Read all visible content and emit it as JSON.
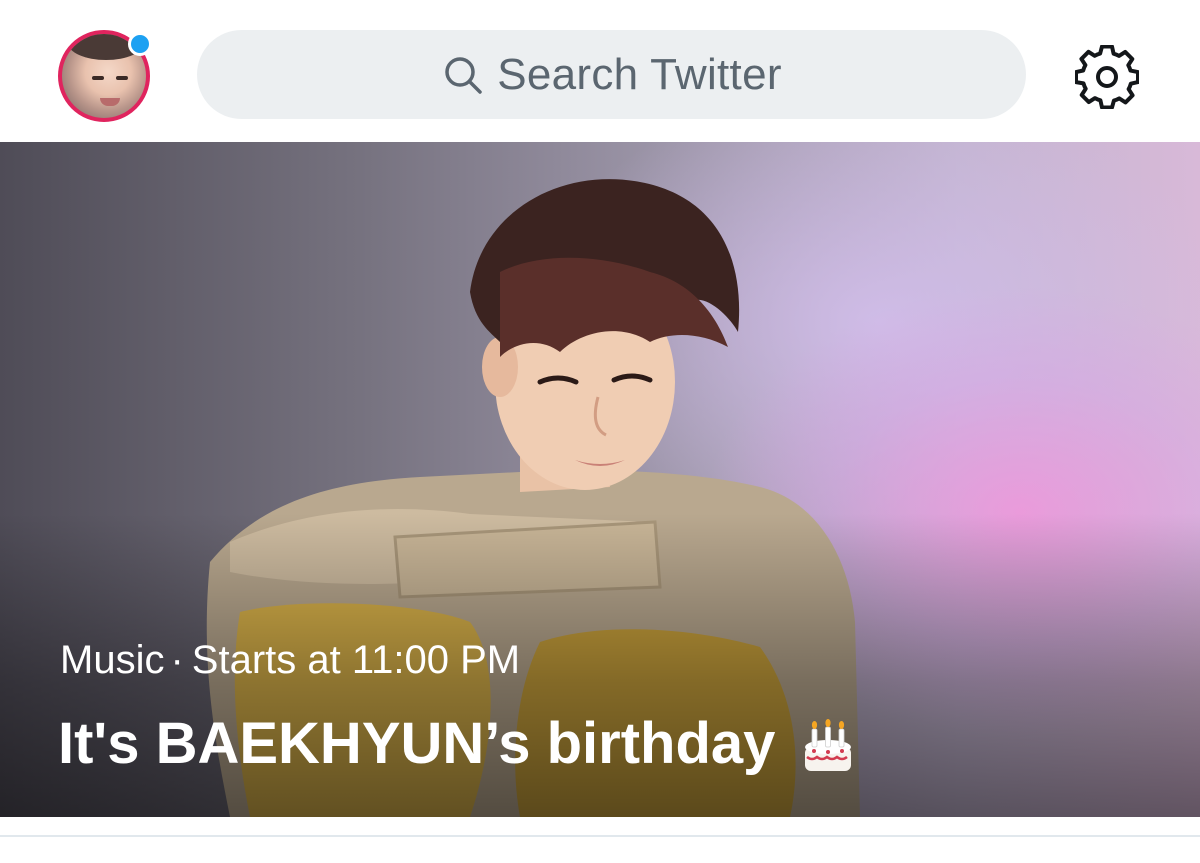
{
  "header": {
    "avatar_alt": "Profile",
    "search": {
      "placeholder": "Search Twitter"
    },
    "settings_icon": "gear-icon"
  },
  "event_card": {
    "category": "Music",
    "separator": "·",
    "time": "Starts at 11:00 PM",
    "title": "It's BAEKHYUN’s birthday",
    "emoji_icon": "birthday-cake-icon"
  },
  "colors": {
    "avatar_ring": "#e0245e",
    "notification_dot": "#1da1f2",
    "search_bg": "#eceff1",
    "search_text": "#5b6670"
  }
}
